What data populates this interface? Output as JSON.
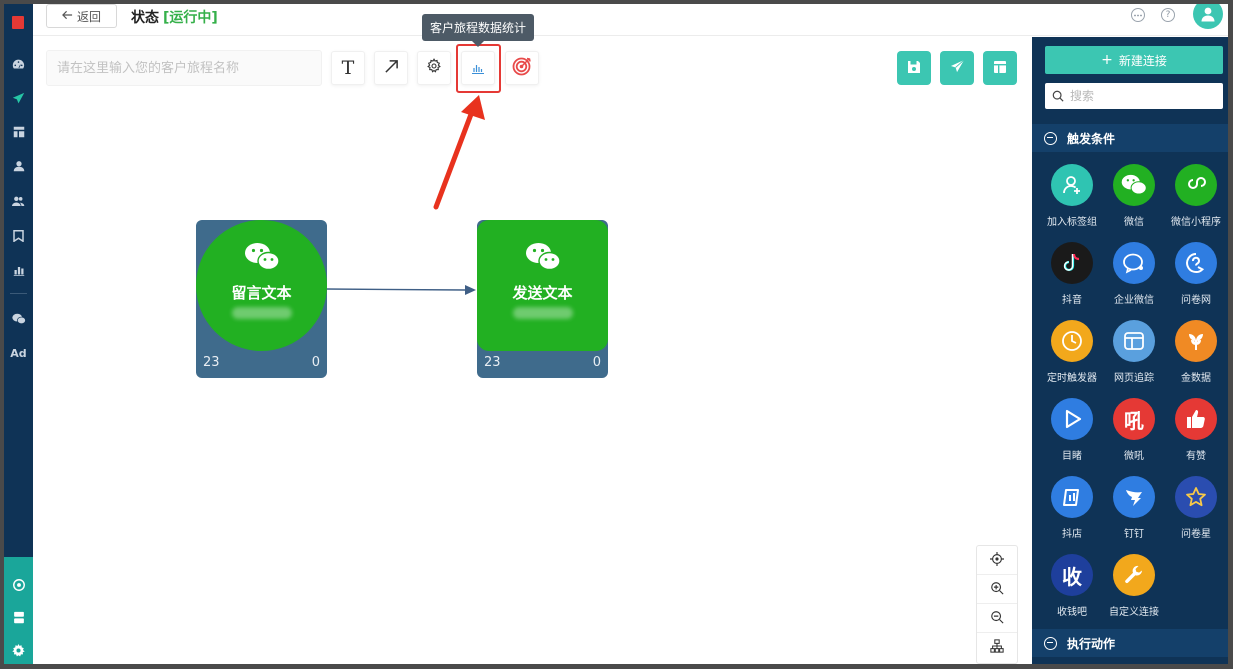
{
  "topbar": {
    "back_label": "返回",
    "status_label": "状态",
    "status_value": "[运行中]"
  },
  "toolbar": {
    "journey_name_placeholder": "请在这里输入您的客户旅程名称",
    "text_tool_glyph": "T",
    "tooltip": "客户旅程数据统计"
  },
  "nodes": [
    {
      "title": "留言文本",
      "left_count": "23",
      "right_count": "0",
      "shape": "circle"
    },
    {
      "title": "发送文本",
      "left_count": "23",
      "right_count": "0",
      "shape": "square"
    }
  ],
  "rail": {
    "ad_label": "Ad"
  },
  "right_panel": {
    "new_connection_label": "新建连接",
    "search_placeholder": "搜索",
    "trigger_section_label": "触发条件",
    "action_section_label": "执行动作",
    "apps": [
      {
        "label": "加入标签组",
        "color": "#2fc4b2",
        "icon": "user-plus-icon"
      },
      {
        "label": "微信",
        "color": "#22b022",
        "icon": "wechat-icon"
      },
      {
        "label": "微信小程序",
        "color": "#22b022",
        "icon": "mini-program-icon"
      },
      {
        "label": "抖音",
        "color": "#1a1a1a",
        "icon": "douyin-icon"
      },
      {
        "label": "企业微信",
        "color": "#2f7de1",
        "icon": "wecom-icon"
      },
      {
        "label": "问卷网",
        "color": "#2f7de1",
        "icon": "wenjuan-icon"
      },
      {
        "label": "定时触发器",
        "color": "#f2a81c",
        "icon": "clock-icon"
      },
      {
        "label": "网页追踪",
        "color": "#5aa0de",
        "icon": "web-track-icon"
      },
      {
        "label": "金数据",
        "color": "#f08a24",
        "icon": "jinshuju-icon"
      },
      {
        "label": "目睹",
        "color": "#2f7de1",
        "icon": "play-icon"
      },
      {
        "label": "微吼",
        "color": "#e53935",
        "icon": "vhall-icon"
      },
      {
        "label": "有赞",
        "color": "#e53935",
        "icon": "thumb-up-icon"
      },
      {
        "label": "抖店",
        "color": "#2f7de1",
        "icon": "doudian-icon"
      },
      {
        "label": "钉钉",
        "color": "#2f7de1",
        "icon": "dingtalk-icon"
      },
      {
        "label": "问卷星",
        "color": "#2a4db0",
        "icon": "star-icon"
      },
      {
        "label": "收钱吧",
        "color": "#1e3f9c",
        "icon": "shouqianba-icon"
      },
      {
        "label": "自定义连接",
        "color": "#f2a81c",
        "icon": "wrench-icon"
      }
    ],
    "glyph_shou": "收",
    "glyph_hou": "吼"
  }
}
